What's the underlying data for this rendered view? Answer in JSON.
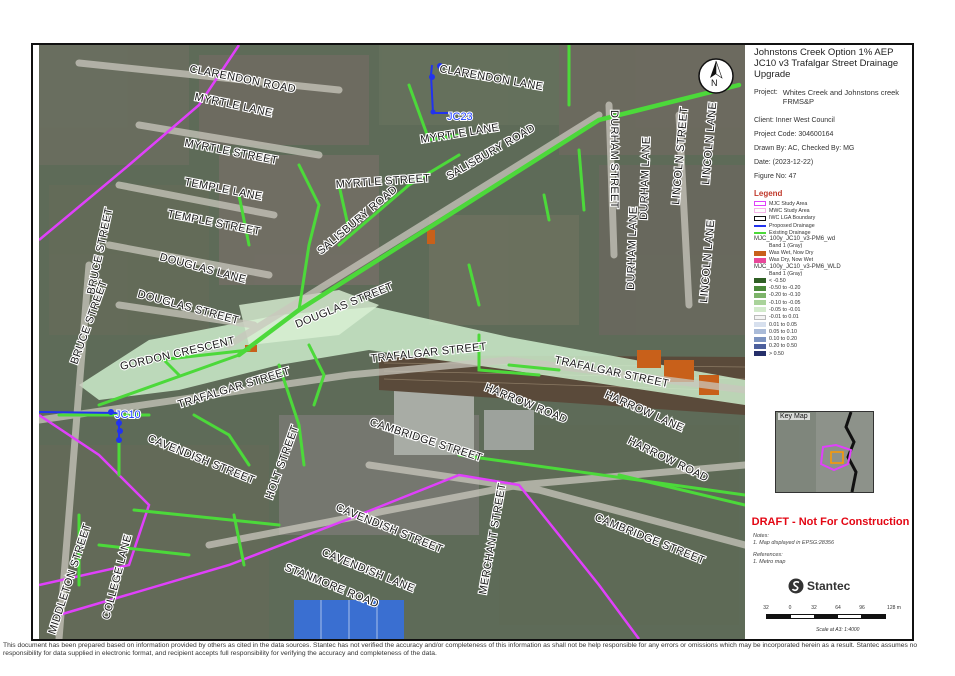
{
  "title": "Johnstons Creek Option 1% AEP JC10 v3 Trafalgar Street Drainage Upgrade",
  "project_label": "Project:",
  "project": "Whites Creek and Johnstons creek FRMS&P",
  "client": "Client:  Inner West Council",
  "project_code": "Project Code:  304600164",
  "drawn_by": "Drawn By:  AC, Checked By: MG",
  "date": "Date:  (2023-12-22)",
  "figure_no": "Figure No:  47",
  "legend": {
    "title": "Legend",
    "items": [
      {
        "label": "MJC Study Area",
        "symbol": "magenta-outline",
        "color": "#e040fb"
      },
      {
        "label": "MWC Study Area",
        "symbol": "pink-outline",
        "color": "#f5b5e8"
      },
      {
        "label": "IWC LGA Boundary",
        "symbol": "black-outline",
        "color": "#111111"
      },
      {
        "label": "Proposed Drainage",
        "symbol": "blue-line",
        "color": "#2233ee"
      },
      {
        "label": "Existing Drainage",
        "symbol": "green-line",
        "color": "#4cd93a"
      }
    ],
    "raster1": {
      "name": "MJC_100y_JC10_v3-PM6_wd",
      "band": "Band 1 (Gray)",
      "classes": [
        {
          "label": "Was Wet, Now Dry",
          "color": "#c8601a"
        },
        {
          "label": "Was Dry, Now Wet",
          "color": "#e8489a"
        }
      ]
    },
    "raster2": {
      "name": "MJC_100y_JC10_v3-PM6_WLD",
      "band": "Band 1 (Gray)",
      "classes": [
        {
          "label": "< -0.50",
          "color": "#2f5f24"
        },
        {
          "label": "-0.50 to -0.20",
          "color": "#4b8a3a"
        },
        {
          "label": "-0.20 to -0.10",
          "color": "#7db46a"
        },
        {
          "label": "-0.10 to -0.05",
          "color": "#a9d39a"
        },
        {
          "label": "-0.05 to -0.01",
          "color": "#d3ebcc"
        },
        {
          "label": "-0.01 to 0.01",
          "color": "#f4f4f4"
        },
        {
          "label": "0.01 to 0.05",
          "color": "#d7e0ee"
        },
        {
          "label": "0.05 to 0.10",
          "color": "#aabbd8"
        },
        {
          "label": "0.10 to 0.20",
          "color": "#7c93c0"
        },
        {
          "label": "0.20 to 0.50",
          "color": "#4c5f9c"
        },
        {
          "label": "> 0.50",
          "color": "#252f6a"
        }
      ]
    }
  },
  "key_map_label": "Key Map",
  "draft": "DRAFT - Not For Construction",
  "notes": "Notes:",
  "note_1": "1. Map displayed in EPSG:28356",
  "references": "References:",
  "reference_1": "1. Metro map",
  "logo_text": "Stantec",
  "scale_ticks": [
    "32",
    "0",
    "32",
    "64",
    "96",
    "128 m"
  ],
  "scale_caption": "Scale at A3: 1:4000",
  "north_label": "N",
  "pits": [
    {
      "label": "JC23"
    },
    {
      "label": "JC10"
    }
  ],
  "streets": [
    {
      "name": "CLARENDON ROAD"
    },
    {
      "name": "CLARENDON LANE"
    },
    {
      "name": "MYRTLE LANE"
    },
    {
      "name": "MYRTLE LANE"
    },
    {
      "name": "MYRTLE STREET"
    },
    {
      "name": "MYRTLE STREET"
    },
    {
      "name": "SALISBURY ROAD"
    },
    {
      "name": "SALISBURY ROAD"
    },
    {
      "name": "TEMPLE LANE"
    },
    {
      "name": "TEMPLE STREET"
    },
    {
      "name": "DOUGLAS LANE"
    },
    {
      "name": "DOUGLAS STREET"
    },
    {
      "name": "DOUGLAS STREET"
    },
    {
      "name": "BRUCE STREET"
    },
    {
      "name": "BRUCE STREET"
    },
    {
      "name": "GORDON CRESCENT"
    },
    {
      "name": "TRAFALGAR STREET"
    },
    {
      "name": "TRAFALGAR STREET"
    },
    {
      "name": "TRAFALGAR STREET"
    },
    {
      "name": "HARROW ROAD"
    },
    {
      "name": "HARROW LANE"
    },
    {
      "name": "HARROW ROAD"
    },
    {
      "name": "CAMBRIDGE STREET"
    },
    {
      "name": "CAMBRIDGE STREET"
    },
    {
      "name": "CAVENDISH STREET"
    },
    {
      "name": "CAVENDISH STREET"
    },
    {
      "name": "CAVENDISH LANE"
    },
    {
      "name": "STANMORE ROAD"
    },
    {
      "name": "HOLT STREET"
    },
    {
      "name": "MIDDLETON STREET"
    },
    {
      "name": "COLLEGE LANE"
    },
    {
      "name": "MERCHANT STREET"
    },
    {
      "name": "DURHAM STREET"
    },
    {
      "name": "DURHAM LANE"
    },
    {
      "name": "DURHAM LANE"
    },
    {
      "name": "LINCOLN STREET"
    },
    {
      "name": "LINCOLN LANE"
    },
    {
      "name": "LINCOLN LANE"
    }
  ],
  "disclaimer": "This document has been prepared based on information provided by others as cited in the data sources. Stantec has not verified the accuracy and/or completeness of this information as shall not be help responsible for any errors or omissions which may be incorporated herein as a result. Stantec assumes no responsibility for data supplied in electronic format, and recipient accepts full responsibility for verifying the accuracy and completeness of the data."
}
